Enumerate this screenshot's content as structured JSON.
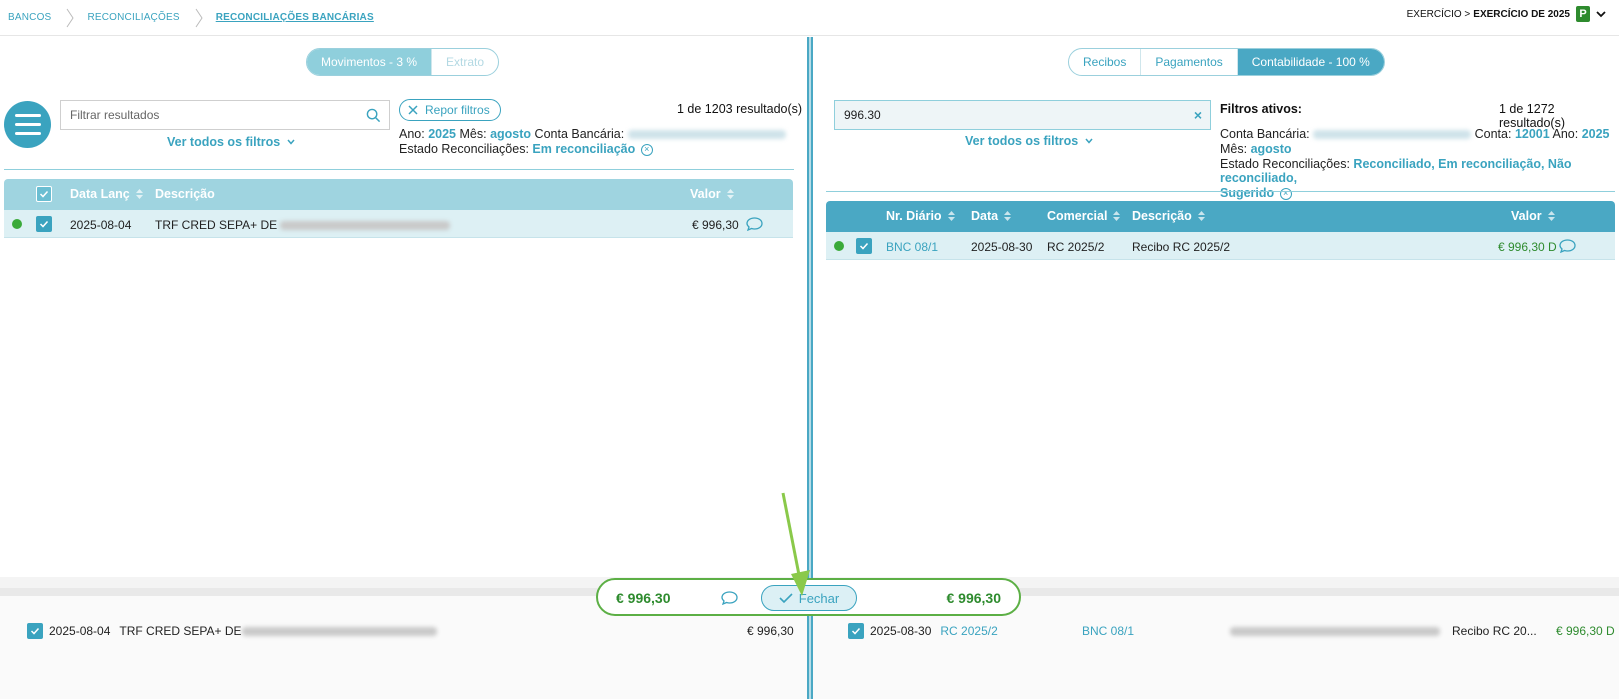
{
  "breadcrumb": {
    "items": [
      "BANCOS",
      "RECONCILIAÇÕES",
      "RECONCILIAÇÕES BANCÁRIAS"
    ]
  },
  "exercise": {
    "prefix": "EXERCÍCIO >",
    "value": "EXERCÍCIO DE 2025",
    "badge": "P"
  },
  "left": {
    "tabs": [
      "Movimentos - 3 %",
      "Extrato"
    ],
    "search_placeholder": "Filtrar resultados",
    "ver_filtros": "Ver todos os filtros",
    "repor": "Repor filtros",
    "result_count": "1 de 1203 resultado(s)",
    "filters": {
      "ano_label": "Ano:",
      "ano": "2025",
      "mes_label": "Mês:",
      "mes": "agosto",
      "conta_label": "Conta Bancária:",
      "estado_label": "Estado Reconciliações:",
      "estado": "Em reconciliação"
    },
    "columns": {
      "data": "Data Lanç",
      "descricao": "Descrição",
      "valor": "Valor"
    },
    "row": {
      "data": "2025-08-04",
      "descricao": "TRF CRED SEPA+ DE",
      "valor": "€ 996,30"
    }
  },
  "right": {
    "tabs": [
      "Recibos",
      "Pagamentos",
      "Contabilidade - 100 %"
    ],
    "search_value": "996.30",
    "ver_filtros": "Ver todos os filtros",
    "filtros_ativos": "Filtros ativos:",
    "result_count": "1 de 1272 resultado(s)",
    "filters": {
      "conta_label": "Conta Bancária:",
      "conta_nr_label": "Conta:",
      "conta_nr": "12001",
      "ano_label": "Ano:",
      "ano": "2025",
      "mes_label": "Mês:",
      "mes": "agosto",
      "estado_label": "Estado Reconciliações:",
      "estado": "Reconciliado, Em reconciliação, Não reconciliado,",
      "estado2": "Sugerido"
    },
    "columns": {
      "diario": "Nr. Diário",
      "data": "Data",
      "comercial": "Comercial",
      "descricao": "Descrição",
      "valor": "Valor"
    },
    "row": {
      "diario": "BNC 08/1",
      "data": "2025-08-30",
      "comercial": "RC 2025/2",
      "descricao": "Recibo RC 2025/2",
      "valor": "€ 996,30 D"
    }
  },
  "summary": {
    "left_amount": "€ 996,30",
    "right_amount": "€ 996,30",
    "fechar": "Fechar"
  },
  "bottom": {
    "left": {
      "data": "2025-08-04",
      "descricao": "TRF CRED SEPA+ DE",
      "valor": "€ 996,30"
    },
    "right": {
      "data": "2025-08-30",
      "comercial": "RC 2025/2",
      "diario": "BNC 08/1",
      "descricao": "Recibo RC 20...",
      "valor": "€ 996,30 D"
    }
  },
  "colors": {
    "accent": "#3aa3bf",
    "green": "#2e8b2e",
    "header_light": "#9fd4e0"
  }
}
